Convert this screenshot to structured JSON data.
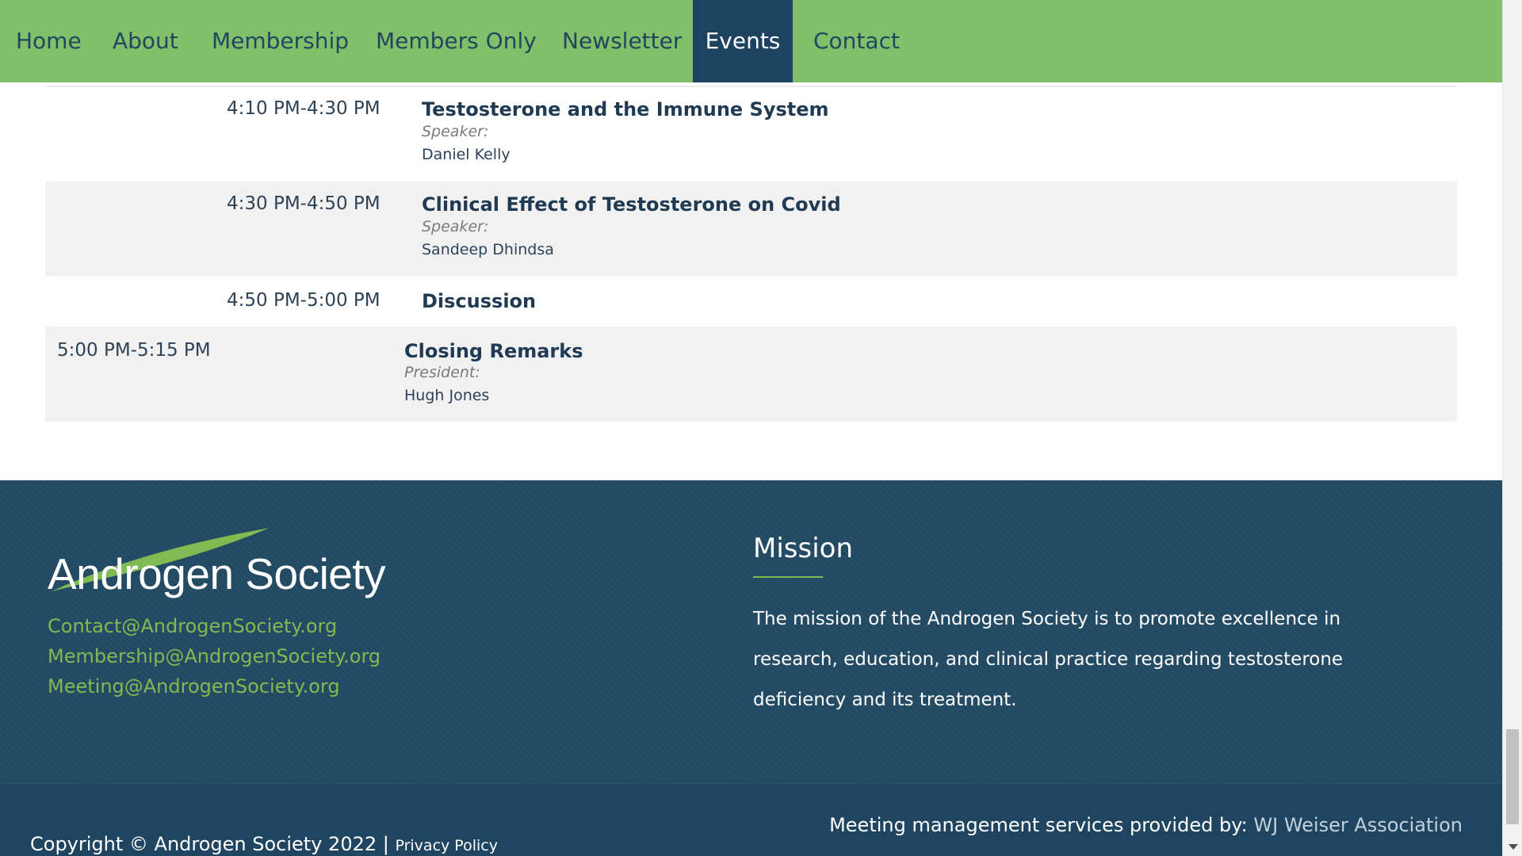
{
  "nav": {
    "items": [
      {
        "label": "Home"
      },
      {
        "label": "About"
      },
      {
        "label": "Membership"
      },
      {
        "label": "Members Only"
      },
      {
        "label": "Newsletter"
      },
      {
        "label": "Events",
        "active": true
      },
      {
        "label": "Contact"
      }
    ]
  },
  "schedule": {
    "rows": [
      {
        "time": "4:10 PM-4:30 PM",
        "title": "Testosterone and the Immune System",
        "role": "Speaker:",
        "person": "Daniel Kelly"
      },
      {
        "time": "4:30 PM-4:50 PM",
        "title": "Clinical Effect of Testosterone on Covid",
        "role": "Speaker:",
        "person": "Sandeep Dhindsa"
      },
      {
        "time": "4:50 PM-5:00 PM",
        "title": "Discussion"
      },
      {
        "time": "5:00 PM-5:15 PM",
        "title": "Closing Remarks",
        "role": "President:",
        "person": "Hugh Jones"
      }
    ]
  },
  "footer": {
    "logo_text": "Androgen Society",
    "emails": [
      "Contact@AndrogenSociety.org",
      "Membership@AndrogenSociety.org",
      "Meeting@AndrogenSociety.org"
    ],
    "mission_heading": "Mission",
    "mission_text": "The mission of the Androgen Society is to promote excellence in research, education, and clinical practice regarding testosterone deficiency and its treatment.",
    "mgmt_prefix": "Meeting management services provided by: ",
    "mgmt_link": "WJ Weiser Association",
    "copyright": "Copyright © Androgen Society 2022 | ",
    "privacy": "Privacy Policy"
  },
  "colors": {
    "nav_bg": "#80c06a",
    "nav_active_bg": "#1c4460",
    "footer_bg": "#234a63",
    "email_green": "#7fba52",
    "row_gray": "#f1f1f1"
  },
  "icons": {
    "scroll_down": "chevron-down-icon"
  }
}
